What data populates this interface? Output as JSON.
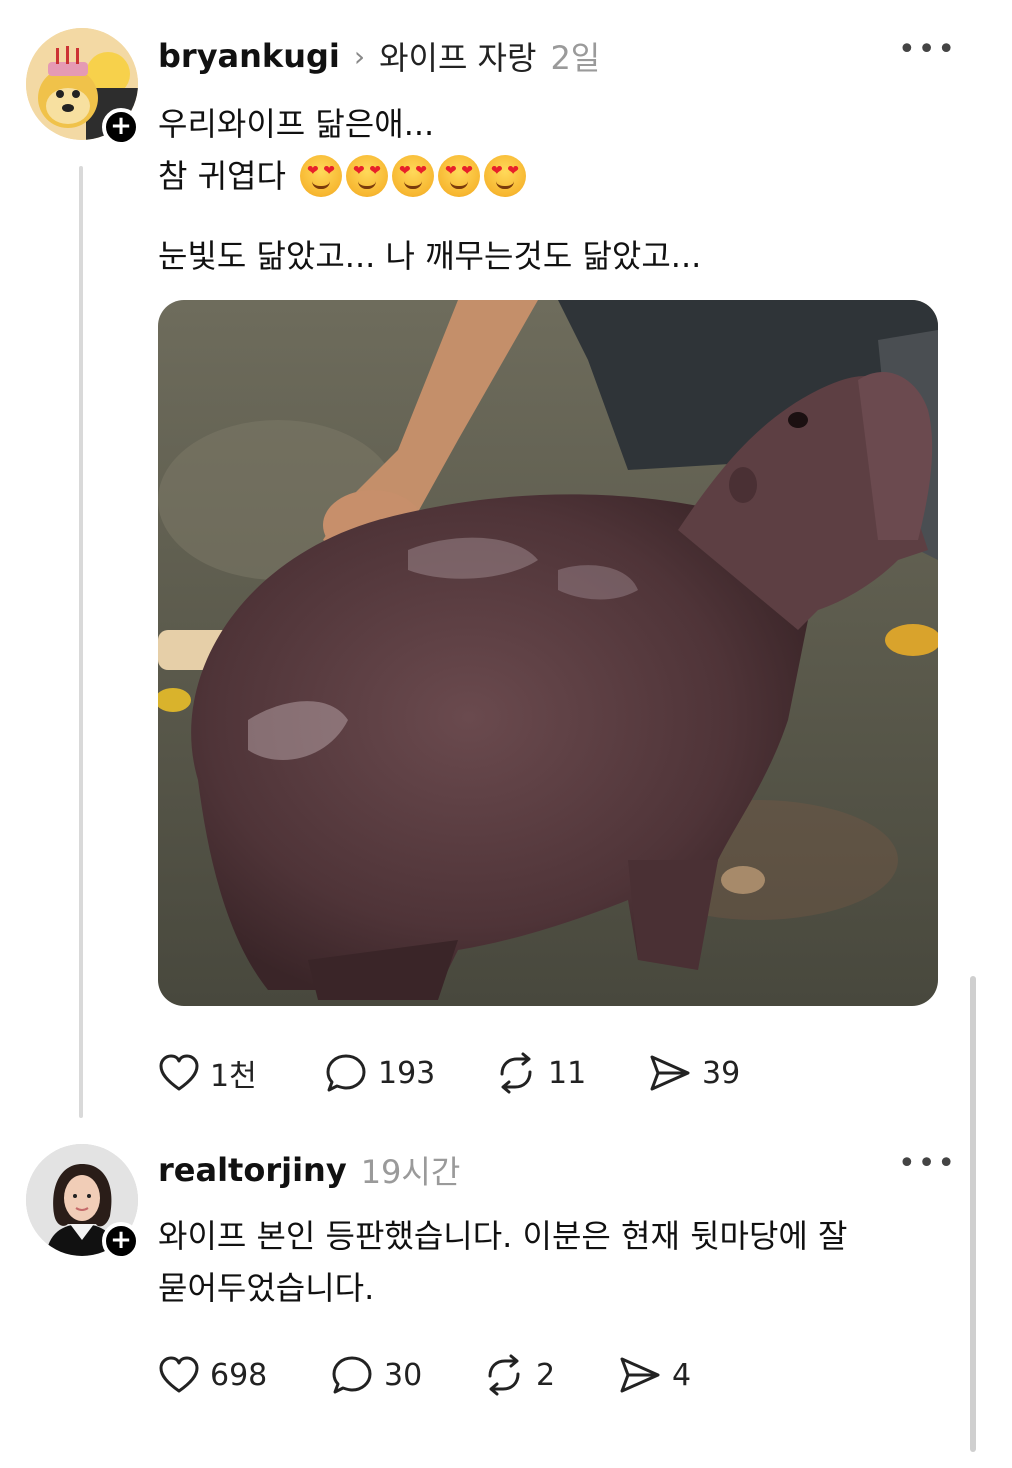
{
  "post": {
    "username": "bryankugi",
    "topic": "와이프 자랑",
    "time": "2일",
    "lines": [
      "우리와이프 닮은애...",
      "참 귀엽다",
      "눈빛도 닮았고... 나 깨무는것도 닮았고..."
    ],
    "emoji": "smiling-face-with-heart-eyes",
    "emoji_count": 5,
    "stats": {
      "likes": "1천",
      "comments": "193",
      "reposts": "11",
      "shares": "39"
    }
  },
  "reply": {
    "username": "realtorjiny",
    "time": "19시간",
    "lines": [
      "와이프 본인 등판했습니다. 이분은 현재 뒷마당에 잘",
      "묻어두었습니다."
    ],
    "stats": {
      "likes": "698",
      "comments": "30",
      "reposts": "2",
      "shares": "4"
    }
  },
  "icons": {
    "more": "more-icon",
    "chevron": "chevron-right-icon",
    "follow": "plus-icon",
    "like": "heart-icon",
    "comment": "comment-icon",
    "repost": "repost-icon",
    "share": "send-icon"
  },
  "colors": {
    "follow_badge": "#000000",
    "muted_text": "#9a9a9a",
    "thread_line": "#d9d9d9"
  }
}
